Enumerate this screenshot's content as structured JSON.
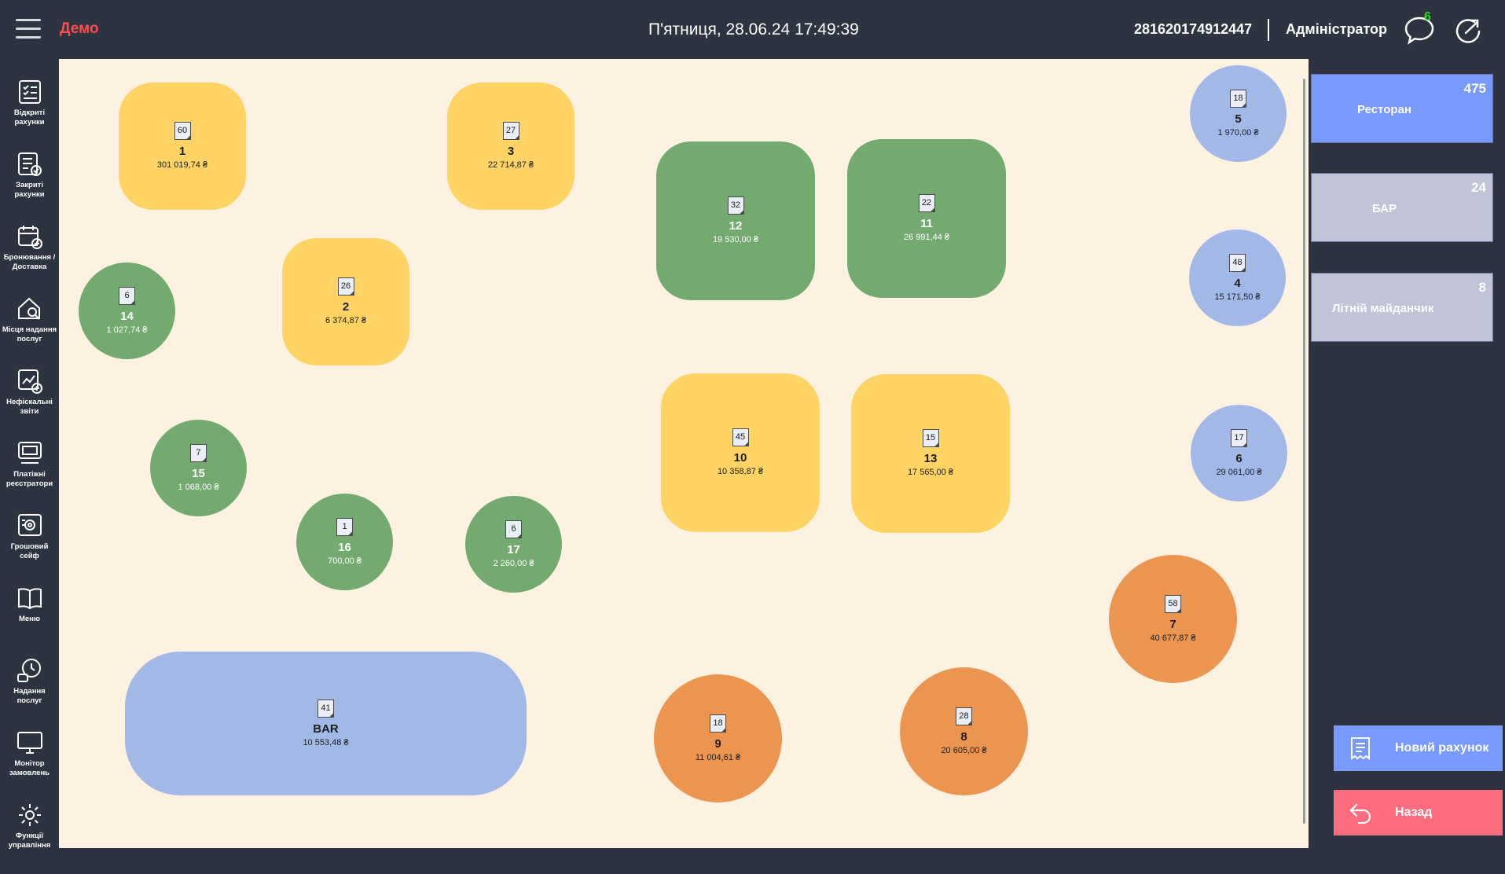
{
  "header": {
    "demo_label": "Демо",
    "datetime": "П'ятниця, 28.06.24 17:49:39",
    "terminal_id": "281620174912447",
    "user_role": "Адміністратор",
    "notifications_count": "6"
  },
  "sidebar": {
    "items": [
      {
        "label": "Відкриті\nрахунки",
        "icon": "open-bills-icon"
      },
      {
        "label": "Закриті\nрахунки",
        "icon": "closed-bills-icon"
      },
      {
        "label": "Бронювання /\nДоставка",
        "icon": "booking-calendar-icon"
      },
      {
        "label": "Місця надання\nпослуг",
        "icon": "service-place-icon"
      },
      {
        "label": "Нефіскальні\nзвіти",
        "icon": "reports-icon"
      },
      {
        "label": "Платіжні\nреєстратори",
        "icon": "payment-register-icon"
      },
      {
        "label": "Грошовий\nсейф",
        "icon": "safe-icon"
      },
      {
        "label": "Меню",
        "icon": "menu-book-icon"
      },
      {
        "label": "Надання\nпослуг",
        "icon": "service-clock-icon"
      },
      {
        "label": "Монітор\nзамовлень",
        "icon": "monitor-icon"
      },
      {
        "label": "Функції\nуправління",
        "icon": "gear-icon"
      }
    ]
  },
  "tables": [
    {
      "id": "1",
      "bills": "60",
      "amount": "301 019,74 ₴",
      "color": "yellow"
    },
    {
      "id": "3",
      "bills": "27",
      "amount": "22 714,87 ₴",
      "color": "yellow"
    },
    {
      "id": "12",
      "bills": "32",
      "amount": "19 530,00 ₴",
      "color": "green"
    },
    {
      "id": "11",
      "bills": "22",
      "amount": "26 991,44 ₴",
      "color": "green"
    },
    {
      "id": "5",
      "bills": "18",
      "amount": "1 970,00 ₴",
      "color": "blue"
    },
    {
      "id": "14",
      "bills": "6",
      "amount": "1 027,74 ₴",
      "color": "green"
    },
    {
      "id": "2",
      "bills": "26",
      "amount": "6 374,87 ₴",
      "color": "yellow"
    },
    {
      "id": "4",
      "bills": "48",
      "amount": "15 171,50 ₴",
      "color": "blue"
    },
    {
      "id": "10",
      "bills": "45",
      "amount": "10 358,87 ₴",
      "color": "yellow"
    },
    {
      "id": "13",
      "bills": "15",
      "amount": "17 565,00 ₴",
      "color": "yellow"
    },
    {
      "id": "15",
      "bills": "7",
      "amount": "1 068,00 ₴",
      "color": "green"
    },
    {
      "id": "6",
      "bills": "17",
      "amount": "29 061,00 ₴",
      "color": "blue"
    },
    {
      "id": "16",
      "bills": "1",
      "amount": "700,00 ₴",
      "color": "green"
    },
    {
      "id": "17",
      "bills": "6",
      "amount": "2 260,00 ₴",
      "color": "green"
    },
    {
      "id": "7",
      "bills": "58",
      "amount": "40 677,87 ₴",
      "color": "orange"
    },
    {
      "id": "BAR",
      "bills": "41",
      "amount": "10 553,48 ₴",
      "color": "blue"
    },
    {
      "id": "9",
      "bills": "18",
      "amount": "11 004,61 ₴",
      "color": "orange"
    },
    {
      "id": "8",
      "bills": "28",
      "amount": "20 605,00 ₴",
      "color": "orange"
    }
  ],
  "halls": [
    {
      "name": "Ресторан",
      "count": "475",
      "active": true
    },
    {
      "name": "БАР",
      "count": "24",
      "active": false
    },
    {
      "name": "Літній майданчик",
      "count": "8",
      "active": false
    }
  ],
  "actions": {
    "new_bill": "Новий рахунок",
    "back": "Назад"
  },
  "colors": {
    "yellow": "#ffd364",
    "green": "#73aa70",
    "blue": "#a2b9e8",
    "orange": "#ec9550",
    "floor": "#fdf2e1",
    "panel": "#2d3340",
    "active_hall": "#7899ff",
    "back_button": "#ff6b7f"
  }
}
